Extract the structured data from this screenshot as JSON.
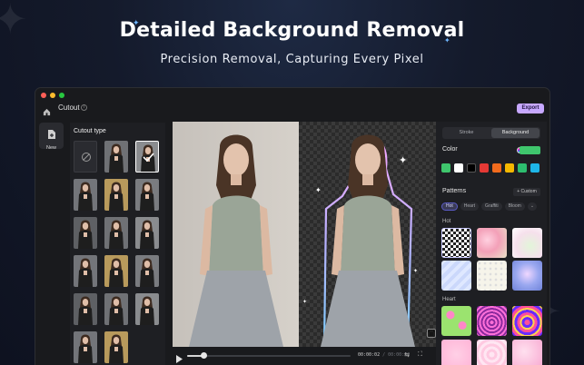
{
  "hero": {
    "title": "Detailed Background Removal",
    "subtitle": "Precision Removal, Capturing Every Pixel"
  },
  "window": {
    "title": "Cutout",
    "export_label": "Export",
    "traffic_colors": [
      "#ff5f57",
      "#febc2e",
      "#28c840"
    ]
  },
  "rail": {
    "items": [
      {
        "label": "New",
        "icon": "new-file-icon"
      }
    ]
  },
  "cutout_panel": {
    "heading": "Cutout type"
  },
  "playback": {
    "current_time": "00:00:02",
    "total_time": "00:00:30",
    "progress": 0.1
  },
  "right_panel": {
    "tabs": [
      {
        "label": "Stroke",
        "active": false
      },
      {
        "label": "Background",
        "active": true
      }
    ],
    "color_label": "Color",
    "color_toggle_color": "#3fc66d",
    "swatches": [
      "#3fc66d",
      "#ffffff",
      "#000000",
      "#e53935",
      "#f26b1d",
      "#f5b800",
      "#2dbd6e",
      "#1eb6e8"
    ],
    "patterns_label": "Patterns",
    "custom_label": "+ Custom",
    "chips": [
      {
        "label": "Hot",
        "active": true
      },
      {
        "label": "Heart",
        "active": false
      },
      {
        "label": "Graffiti",
        "active": false
      },
      {
        "label": "Bloom",
        "active": false
      }
    ],
    "section_hot": "Hot",
    "section_heart": "Heart"
  },
  "colors": {
    "accent": "#c7a8ff",
    "background": "#141a2b",
    "sparkle": "#6fb6ff"
  }
}
